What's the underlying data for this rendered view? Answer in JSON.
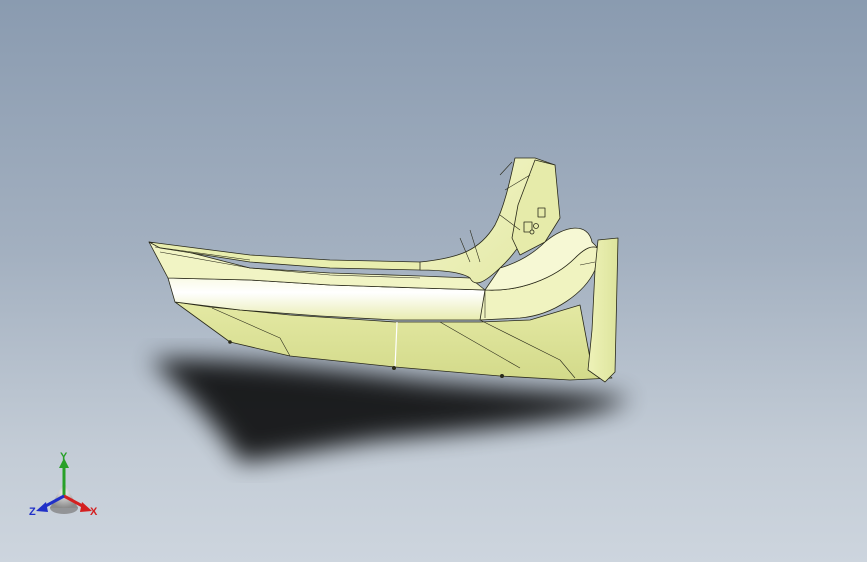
{
  "viewport": {
    "background_top": "#8a9bb0",
    "background_bottom": "#cdd5de"
  },
  "model": {
    "part_color": "#eef0b4",
    "part_shade_color": "#d6dc8e",
    "highlight_color": "#ffffff",
    "edge_color": "#2a2a1a",
    "shadow_color": "#000000"
  },
  "triad": {
    "x_label": "X",
    "y_label": "Y",
    "z_label": "Z",
    "x_color": "#d42020",
    "y_color": "#28a028",
    "z_color": "#2030c8"
  }
}
